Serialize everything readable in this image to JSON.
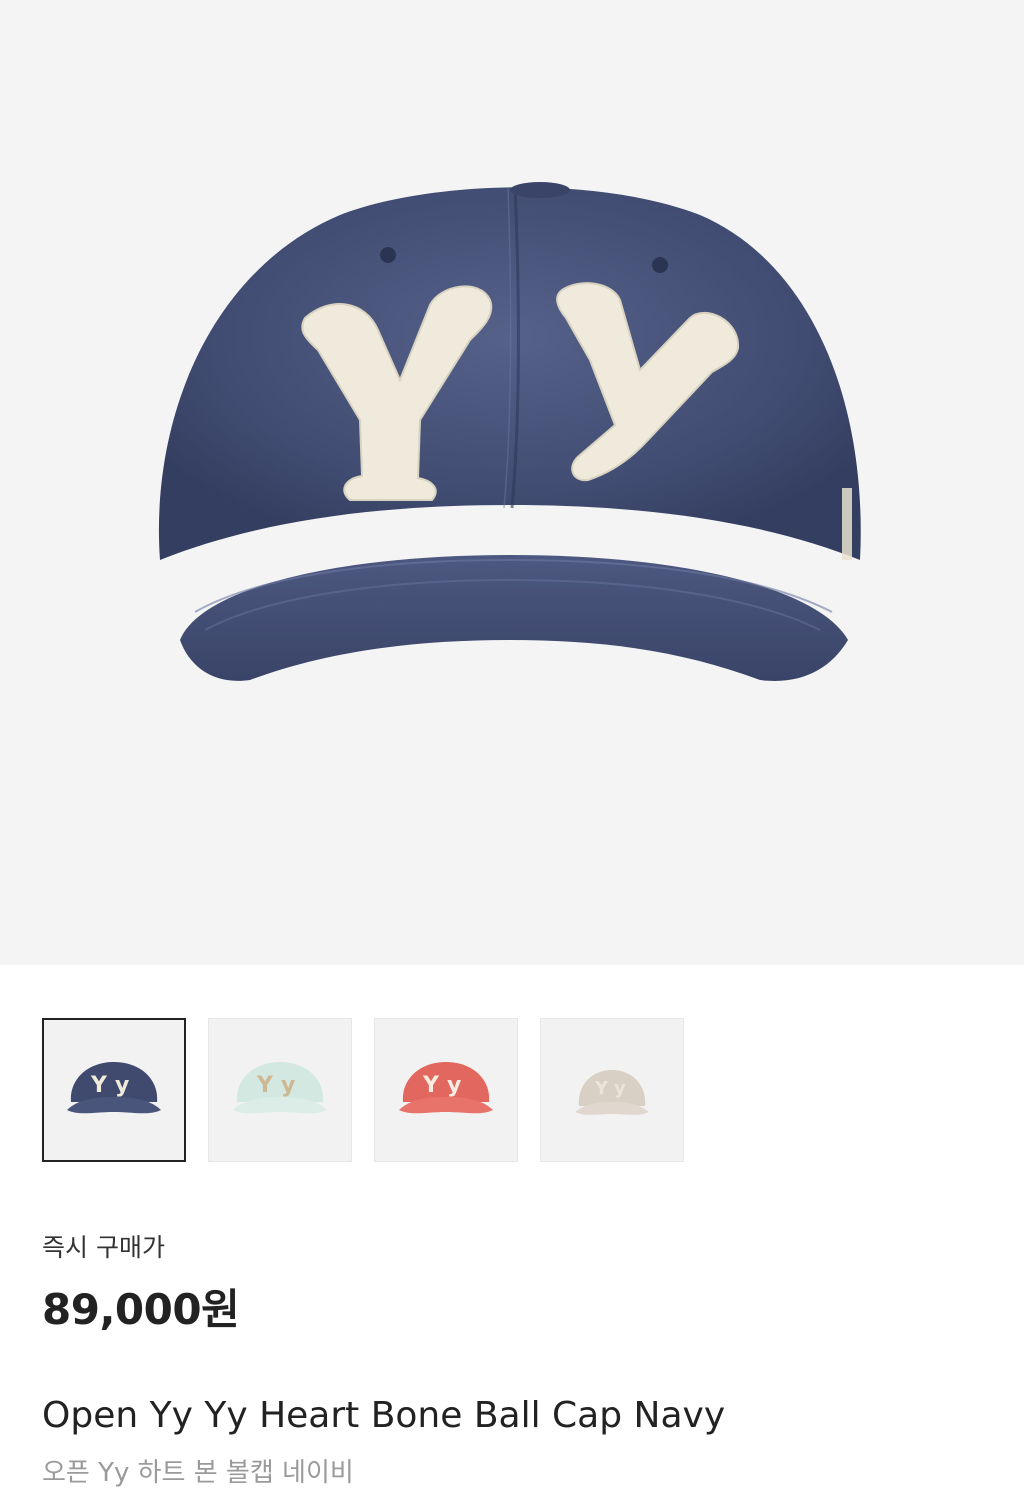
{
  "product": {
    "price_label": "즉시 구매가",
    "price": "89,000원",
    "name_en": "Open Yy Yy Heart Bone Ball Cap Navy",
    "name_ko": "오픈 Yy 하트 본 볼캡 네이비"
  },
  "hero": {
    "logo_text": "Yy"
  },
  "thumbnails": [
    {
      "color_name": "navy",
      "cap": "#3f4a6e",
      "logo": "#f1ecd9",
      "selected": true
    },
    {
      "color_name": "mint",
      "cap": "#d4e8e2",
      "logo": "#cdb893",
      "selected": false
    },
    {
      "color_name": "coral",
      "cap": "#e2675f",
      "logo": "#f6ece0",
      "selected": false
    },
    {
      "color_name": "beige",
      "cap": "#d9d0c5",
      "logo": "#ece4d8",
      "selected": false
    }
  ],
  "colors": {
    "hero_background": "#f4f4f4",
    "price_text": "#222222",
    "subtitle_text": "#9a9a9a"
  }
}
